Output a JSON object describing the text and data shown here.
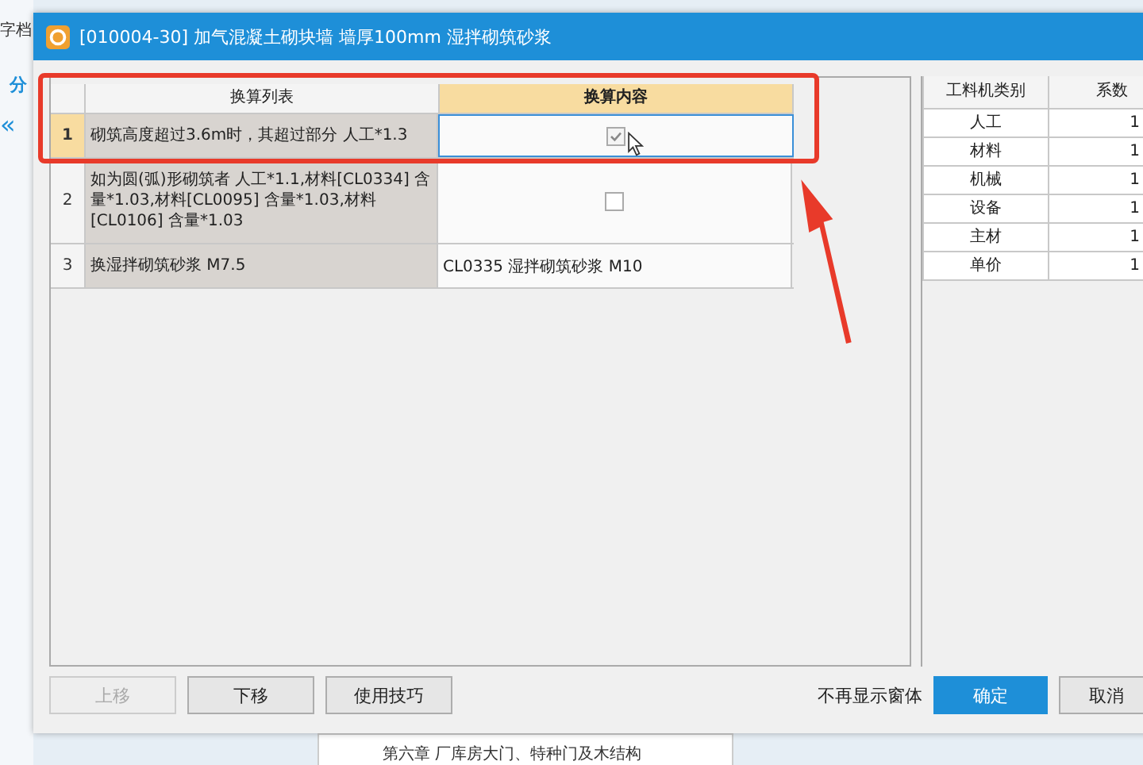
{
  "background": {
    "left_label": "字档",
    "tab": "分",
    "collapse": "«",
    "bottom_item": "第六章 厂库房大门、特种门及木结构"
  },
  "dialog": {
    "title": "[010004-30] 加气混凝土砌块墙 墙厚100mm 湿拌砌筑砂浆",
    "table": {
      "columns": [
        {
          "label": "换算列表",
          "selected": false
        },
        {
          "label": "换算内容",
          "selected": true
        }
      ],
      "rows": [
        {
          "index": "1",
          "text": "砌筑高度超过3.6m时，其超过部分 人工*1.3",
          "selected": true,
          "kind": "checkbox",
          "checked": true
        },
        {
          "index": "2",
          "text": "如为圆(弧)形砌筑者 人工*1.1,材料[CL0334] 含量*1.03,材料[CL0095] 含量*1.03,材料[CL0106] 含量*1.03",
          "selected": false,
          "kind": "checkbox",
          "checked": false
        },
        {
          "index": "3",
          "text": "换湿拌砌筑砂浆  M7.5",
          "selected": false,
          "kind": "text",
          "value": "CL0335  湿拌砌筑砂浆 M10"
        }
      ]
    },
    "coef_table": {
      "columns": [
        "工料机类别",
        "系数"
      ],
      "rows": [
        {
          "category": "人工",
          "value": "1"
        },
        {
          "category": "材料",
          "value": "1"
        },
        {
          "category": "机械",
          "value": "1"
        },
        {
          "category": "设备",
          "value": "1"
        },
        {
          "category": "主材",
          "value": "1"
        },
        {
          "category": "单价",
          "value": "1"
        }
      ]
    },
    "buttons": [
      {
        "label": "上移",
        "disabled": true
      },
      {
        "label": "下移",
        "disabled": false
      },
      {
        "label": "使用技巧",
        "disabled": false
      }
    ],
    "dont_show_label": "不再显示窗体",
    "ok": "确定",
    "cancel": "取消"
  }
}
